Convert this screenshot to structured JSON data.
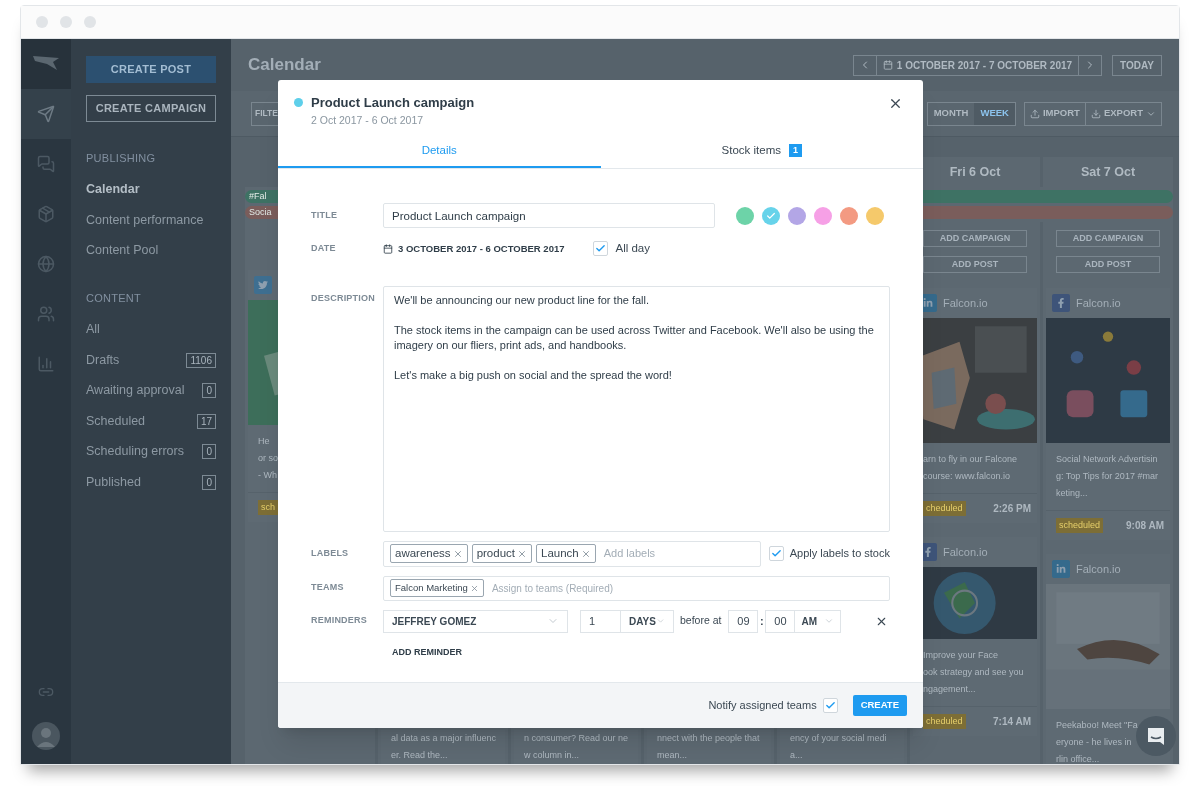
{
  "rail": [
    {
      "kind": "publish",
      "selected": true
    },
    {
      "kind": "engage",
      "selected": false
    },
    {
      "kind": "content",
      "selected": false
    },
    {
      "kind": "listen",
      "selected": false
    },
    {
      "kind": "audience",
      "selected": false
    },
    {
      "kind": "measure",
      "selected": false
    }
  ],
  "sidebar": {
    "buttons": [
      {
        "kind": "primary",
        "label": "CREATE POST"
      },
      {
        "kind": "outline",
        "label": "CREATE CAMPAIGN"
      }
    ],
    "sections": [
      {
        "heading": "PUBLISHING",
        "items": [
          {
            "label": "Calendar",
            "selected": true
          },
          {
            "label": "Content performance",
            "selected": false
          },
          {
            "label": "Content Pool",
            "selected": false
          }
        ]
      },
      {
        "heading": "CONTENT",
        "items": [
          {
            "label": "All",
            "selected": false
          },
          {
            "label": "Drafts",
            "count": "1106",
            "selected": false
          },
          {
            "label": "Awaiting approval",
            "count": "0",
            "selected": false
          },
          {
            "label": "Scheduled",
            "count": "17",
            "selected": false
          },
          {
            "label": "Scheduling errors",
            "count": "0",
            "selected": false
          },
          {
            "label": "Published",
            "count": "0",
            "selected": false
          }
        ]
      }
    ]
  },
  "calendar": {
    "title": "Calendar",
    "range": "1 OCTOBER 2017 - 7 OCTOBER 2017",
    "today": "TODAY",
    "filter": "FILTE",
    "views": [
      {
        "label": "MONTH",
        "selected": false
      },
      {
        "label": "WEEK",
        "selected": true
      }
    ],
    "actions": [
      {
        "kind": "import",
        "label": "IMPORT"
      },
      {
        "kind": "export",
        "label": "EXPORT"
      }
    ],
    "campaigns": [
      {
        "label": "#Fal",
        "color": "#3e7264"
      },
      {
        "label": "Socia",
        "color": "#7a5d5b"
      }
    ],
    "days": [
      {
        "kind": "full",
        "posts": [
          {
            "kind": "twitter",
            "lines": [
              "He",
              "or so",
              "- Wh"
            ],
            "status": "sch"
          }
        ]
      },
      {
        "kind": "covered",
        "posts": [
          {
            "lines": [
              "al data as a major influenc",
              "er. Read the..."
            ]
          }
        ]
      },
      {
        "kind": "covered",
        "posts": [
          {
            "lines": [
              "n consumer? Read our ne",
              "w column in..."
            ]
          }
        ]
      },
      {
        "kind": "covered",
        "posts": [
          {
            "lines": [
              "nnect with the people that",
              "mean..."
            ]
          }
        ]
      },
      {
        "kind": "covered",
        "posts": [
          {
            "lines": [
              "ency of your social medi",
              "a..."
            ]
          }
        ]
      },
      {
        "kind": "full",
        "header": "Fri 6 Oct",
        "buttons": [
          "ADD CAMPAIGN",
          "ADD POST"
        ],
        "posts": [
          {
            "kind": "linkedin",
            "account": "Falcon.io",
            "lines": [
              "arn to fly in our Falcone",
              "course: www.falcon.io"
            ],
            "status": "cheduled",
            "time": "2:26 PM"
          },
          {
            "kind": "facebook",
            "account": "Falcon.io",
            "lines": [
              "Improve your Face",
              "ook strategy and see you",
              "ngagement..."
            ],
            "status": "cheduled",
            "time": "7:14 AM"
          }
        ]
      },
      {
        "kind": "full",
        "header": "Sat 7 Oct",
        "buttons": [
          "ADD CAMPAIGN",
          "ADD POST"
        ],
        "posts": [
          {
            "kind": "facebook",
            "account": "Falcon.io",
            "lines": [
              "Social Network Advertisin",
              "g: Top Tips for 2017 #mar",
              "keting..."
            ],
            "status": "scheduled",
            "time": "9:08 AM"
          },
          {
            "kind": "linkedin",
            "account": "Falcon.io",
            "lines": [
              "Peekaboo! Meet \"Fa",
              "eryone - he lives in",
              "rlin office..."
            ]
          }
        ]
      }
    ]
  },
  "modal": {
    "title": "Product Launch campaign",
    "color": "#5ecfea",
    "subtitle": "2 Oct 2017 - 6 Oct 2017",
    "tabs": [
      {
        "label": "Details",
        "selected": true
      },
      {
        "label": "Stock items",
        "count": "1",
        "selected": false
      }
    ],
    "title_label": "TITLE",
    "title_value": "Product Launch campaign",
    "colors": [
      {
        "color": "#6dd3a8",
        "selected": false
      },
      {
        "color": "#67d3ea",
        "selected": true
      },
      {
        "color": "#b3a6e6",
        "selected": false
      },
      {
        "color": "#f6a0e6",
        "selected": false
      },
      {
        "color": "#f39a82",
        "selected": false
      },
      {
        "color": "#f5c96b",
        "selected": false
      }
    ],
    "date_label": "DATE",
    "date_value": "3 OCTOBER 2017 - 6 OCTOBER 2017",
    "all_day": {
      "label": "All day",
      "checked": true
    },
    "description_label": "DESCRIPTION",
    "description": "We'll be announcing our new product line for the fall.\n\nThe stock items in the campaign can be used across Twitter and Facebook. We'll also be using the imagery on our fliers, print ads, and handbooks.\n\nLet's make a big push on social and the spread the word!",
    "labels_label": "LABELS",
    "labels": [
      "awareness",
      "product",
      "Launch"
    ],
    "labels_placeholder": "Add labels",
    "apply_labels": {
      "label": "Apply labels to stock",
      "checked": true
    },
    "teams_label": "TEAMS",
    "teams": [
      "Falcon Marketing"
    ],
    "teams_placeholder": "Assign to teams (Required)",
    "reminders_label": "REMINDERS",
    "reminder": {
      "person": "JEFFREY GOMEZ",
      "amount": "1",
      "unit": "DAYS",
      "before": "before at",
      "hour": "09",
      "separator": ":",
      "minute": "00",
      "period": "AM"
    },
    "add_reminder": "ADD REMINDER",
    "notify": {
      "label": "Notify assigned teams",
      "checked": true
    },
    "create": "CREATE"
  }
}
